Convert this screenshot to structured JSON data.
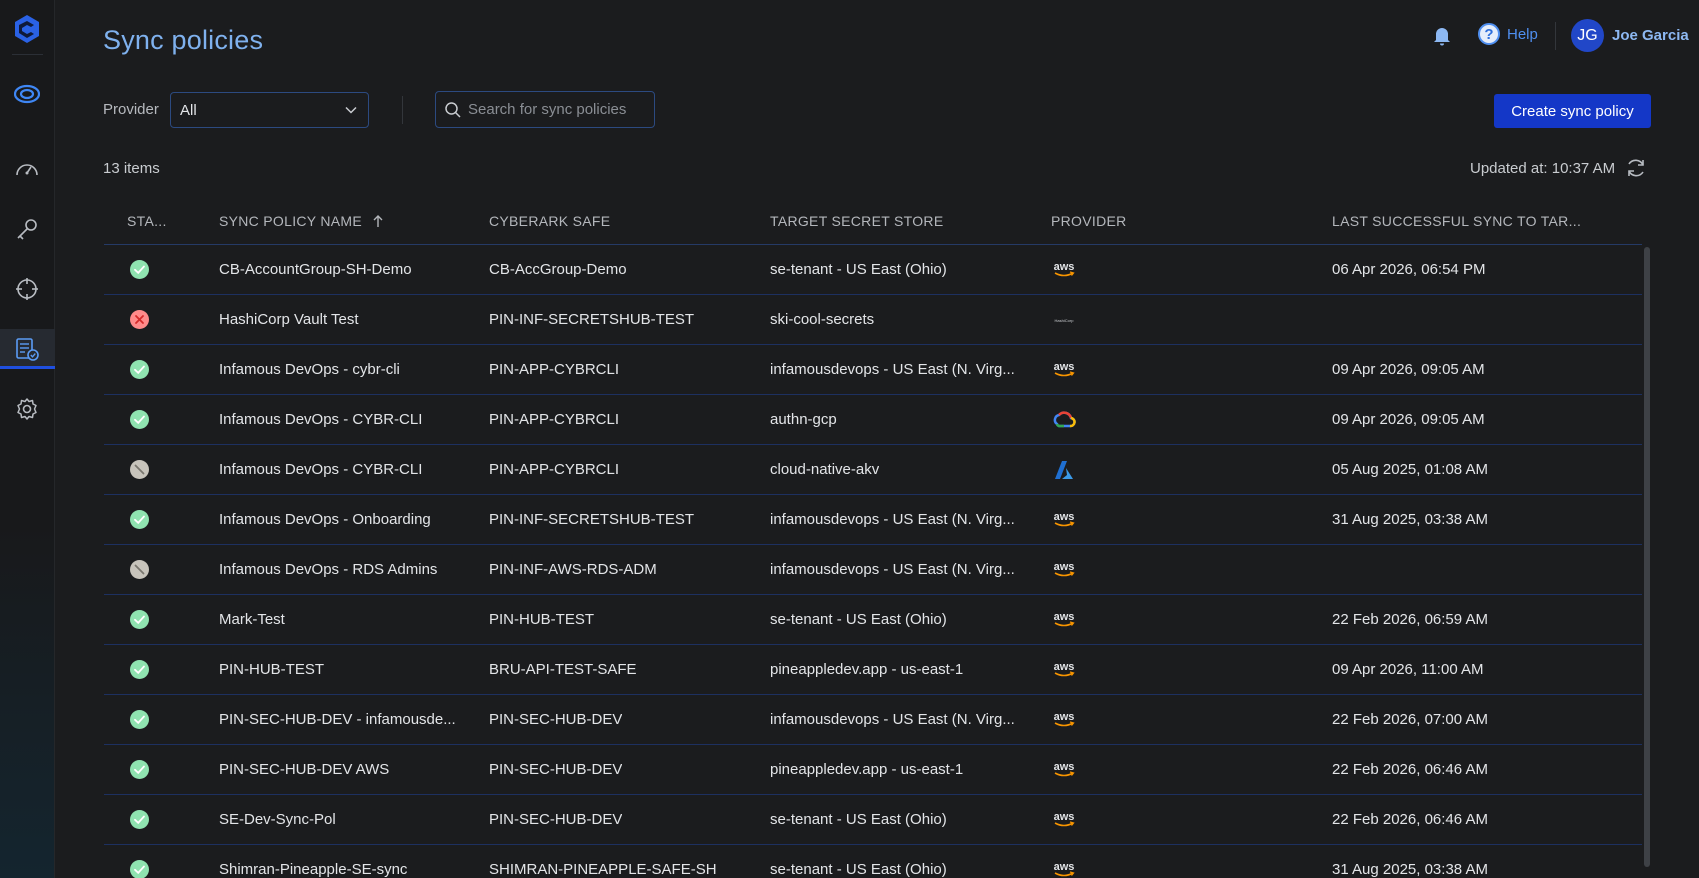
{
  "header": {
    "title": "Sync policies",
    "help_label": "Help",
    "user_initials": "JG",
    "user_name": "Joe Garcia"
  },
  "toolbar": {
    "provider_label": "Provider",
    "provider_value": "All",
    "search_placeholder": "Search for sync policies",
    "create_label": "Create sync policy"
  },
  "summary": {
    "items": "13 items",
    "updated": "Updated at: 10:37 AM"
  },
  "table": {
    "columns": [
      "STA...",
      "SYNC POLICY NAME",
      "CYBERARK SAFE",
      "TARGET SECRET STORE",
      "PROVIDER",
      "LAST SUCCESSFUL SYNC TO TAR..."
    ],
    "rows": [
      {
        "status": "success",
        "name": "CB-AccountGroup-SH-Demo",
        "safe": "CB-AccGroup-Demo",
        "target": "se-tenant - US East (Ohio)",
        "provider": "aws",
        "last_sync": "06 Apr 2026, 06:54 PM"
      },
      {
        "status": "error",
        "name": "HashiCorp Vault Test",
        "safe": "PIN-INF-SECRETSHUB-TEST",
        "target": "ski-cool-secrets",
        "provider": "hashicorp",
        "last_sync": ""
      },
      {
        "status": "success",
        "name": "Infamous DevOps - cybr-cli",
        "safe": "PIN-APP-CYBRCLI",
        "target": "infamousdevops - US East (N. Virg...",
        "provider": "aws",
        "last_sync": "09 Apr 2026, 09:05 AM"
      },
      {
        "status": "success",
        "name": "Infamous DevOps - CYBR-CLI",
        "safe": "PIN-APP-CYBRCLI",
        "target": "authn-gcp",
        "provider": "gcp",
        "last_sync": "09 Apr 2026, 09:05 AM"
      },
      {
        "status": "disabled",
        "name": "Infamous DevOps - CYBR-CLI",
        "safe": "PIN-APP-CYBRCLI",
        "target": "cloud-native-akv",
        "provider": "azure",
        "last_sync": "05 Aug 2025, 01:08 AM"
      },
      {
        "status": "success",
        "name": "Infamous DevOps - Onboarding",
        "safe": "PIN-INF-SECRETSHUB-TEST",
        "target": "infamousdevops - US East (N. Virg...",
        "provider": "aws",
        "last_sync": "31 Aug 2025, 03:38 AM"
      },
      {
        "status": "disabled",
        "name": "Infamous DevOps - RDS Admins",
        "safe": "PIN-INF-AWS-RDS-ADM",
        "target": "infamousdevops - US East (N. Virg...",
        "provider": "aws",
        "last_sync": ""
      },
      {
        "status": "success",
        "name": "Mark-Test",
        "safe": "PIN-HUB-TEST",
        "target": "se-tenant - US East (Ohio)",
        "provider": "aws",
        "last_sync": "22 Feb 2026, 06:59 AM"
      },
      {
        "status": "success",
        "name": "PIN-HUB-TEST",
        "safe": "BRU-API-TEST-SAFE",
        "target": "pineappledev.app - us-east-1",
        "provider": "aws",
        "last_sync": "09 Apr 2026, 11:00 AM"
      },
      {
        "status": "success",
        "name": "PIN-SEC-HUB-DEV - infamousde...",
        "safe": "PIN-SEC-HUB-DEV",
        "target": "infamousdevops - US East (N. Virg...",
        "provider": "aws",
        "last_sync": "22 Feb 2026, 07:00 AM"
      },
      {
        "status": "success",
        "name": "PIN-SEC-HUB-DEV AWS",
        "safe": "PIN-SEC-HUB-DEV",
        "target": "pineappledev.app - us-east-1",
        "provider": "aws",
        "last_sync": "22 Feb 2026, 06:46 AM"
      },
      {
        "status": "success",
        "name": "SE-Dev-Sync-Pol",
        "safe": "PIN-SEC-HUB-DEV",
        "target": "se-tenant - US East (Ohio)",
        "provider": "aws",
        "last_sync": "22 Feb 2026, 06:46 AM"
      },
      {
        "status": "success",
        "name": "Shimran-Pineapple-SE-sync",
        "safe": "SHIMRAN-PINEAPPLE-SAFE-SH",
        "target": "se-tenant - US East (Ohio)",
        "provider": "aws",
        "last_sync": "31 Aug 2025, 03:38 AM"
      }
    ]
  },
  "provider_icon_text": {
    "aws": "aws",
    "hashicorp": "HashiCorp"
  },
  "colors": {
    "accent": "#1437c7",
    "title": "#7fb1ee",
    "success": "#8fe3b0",
    "error": "#ff8a8a",
    "disabled": "#c8c4bc"
  }
}
